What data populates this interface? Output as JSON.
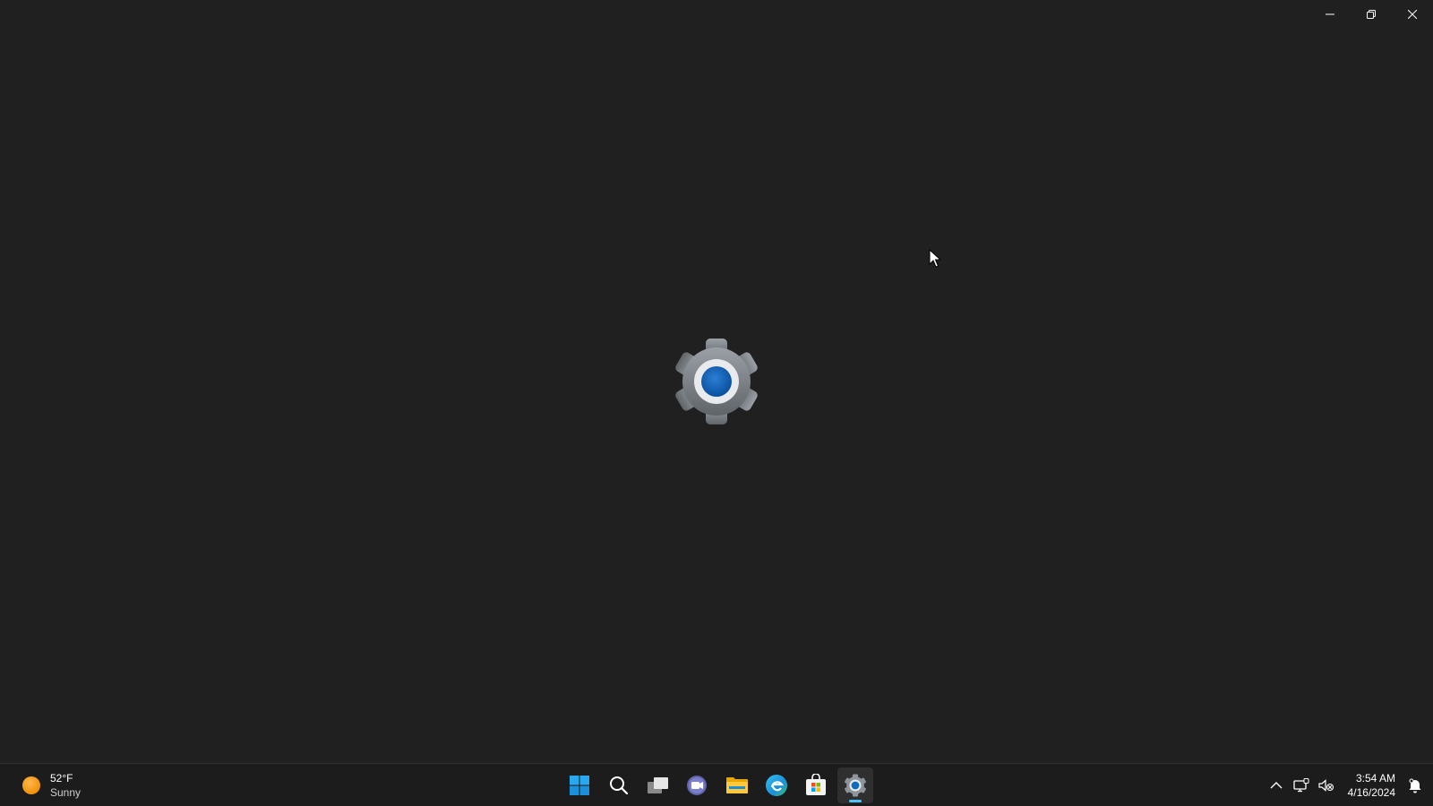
{
  "window": {
    "caption": {
      "minimize_icon": "minimize-icon",
      "restore_icon": "restore-icon",
      "close_icon": "close-icon"
    },
    "splash_icon": "settings-gear-icon",
    "accent_color": "#0f6cbd"
  },
  "taskbar": {
    "weather": {
      "temperature": "52°F",
      "condition": "Sunny",
      "icon": "sun-icon"
    },
    "apps": [
      {
        "name": "Start",
        "icon": "windows-start-icon"
      },
      {
        "name": "Search",
        "icon": "search-icon"
      },
      {
        "name": "Task View",
        "icon": "task-view-icon"
      },
      {
        "name": "Teams Chat",
        "icon": "chat-icon"
      },
      {
        "name": "File Explorer",
        "icon": "folder-icon"
      },
      {
        "name": "Microsoft Edge",
        "icon": "edge-icon"
      },
      {
        "name": "Microsoft Store",
        "icon": "store-icon"
      },
      {
        "name": "Settings",
        "icon": "settings-gear-icon",
        "active": true
      }
    ],
    "tray": {
      "chevron_icon": "chevron-up-icon",
      "network_icon": "network-icon",
      "volume_icon": "volume-muted-icon",
      "notification_icon": "notification-bell-icon"
    },
    "clock": {
      "time": "3:54 AM",
      "date": "4/16/2024"
    }
  }
}
